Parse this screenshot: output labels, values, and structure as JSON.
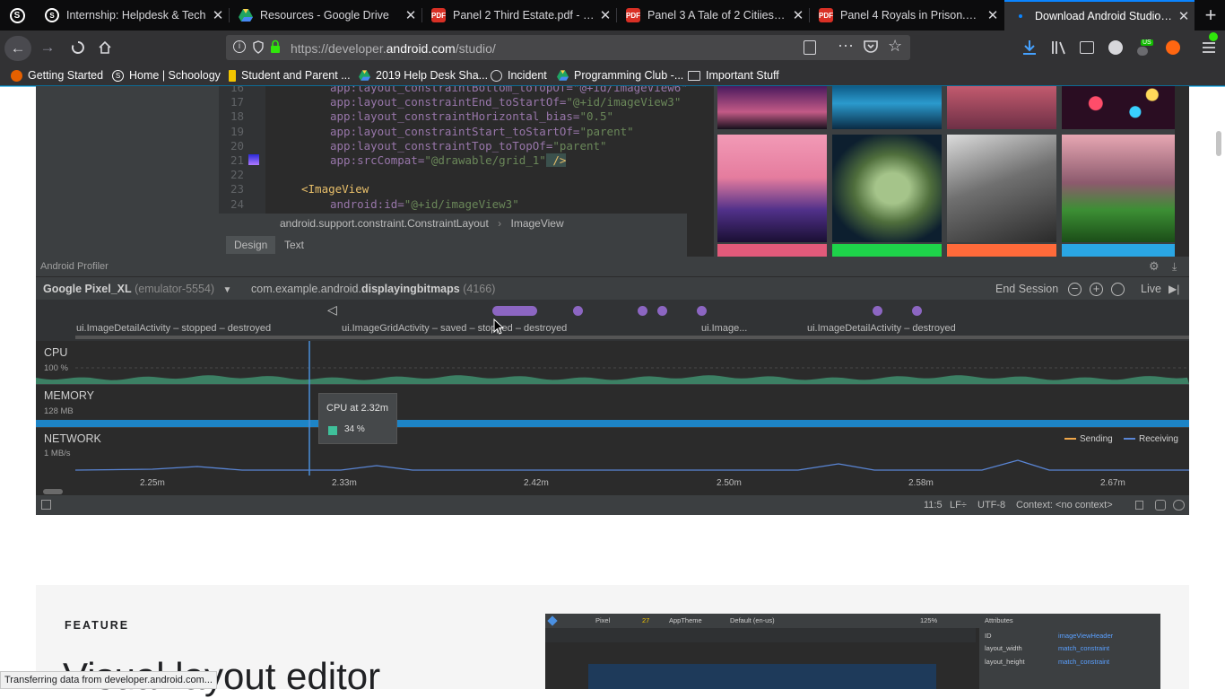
{
  "browser": {
    "tabs": [
      {
        "label": "Internship: Helpdesk & Tech",
        "icon": "schoology-icon"
      },
      {
        "label": "Resources - Google Drive",
        "icon": "google-drive-icon"
      },
      {
        "label": "Panel 2 Third Estate.pdf - Go",
        "icon": "pdf-icon"
      },
      {
        "label": "Panel 3 A Tale of 2 Citiies.pdf",
        "icon": "pdf-icon"
      },
      {
        "label": "Panel 4 Royals in Prison.pdf -",
        "icon": "pdf-icon"
      },
      {
        "label": "Download Android Studio and",
        "icon": "loading-dot-icon"
      }
    ],
    "pdf_badge": "PDF",
    "url_host_prefix": "https://developer.",
    "url_host_main": "android.com",
    "url_path": "/studio/",
    "bookmarks": [
      {
        "label": "Getting Started",
        "icon": "firefox-icon"
      },
      {
        "label": "Home | Schoology",
        "icon": "schoology-icon"
      },
      {
        "label": "Student and Parent ...",
        "icon": "bookmark-flag-icon"
      },
      {
        "label": "2019 Help Desk Sha...",
        "icon": "google-drive-icon"
      },
      {
        "label": "Incident",
        "icon": "globe-icon"
      },
      {
        "label": "Programming Club -...",
        "icon": "google-drive-icon"
      },
      {
        "label": "Important Stuff",
        "icon": "folder-icon"
      }
    ],
    "extension_badge": "US",
    "status_text": "Transferring data from developer.android.com..."
  },
  "code": {
    "lines": [
      {
        "num": "16",
        "text": "app:layout_constraintBottom_toTopOf=\"@+id/imageView6\""
      },
      {
        "num": "17",
        "attr": "app:layout_constraintEnd_toStartOf=",
        "val": "\"@+id/imageView3\""
      },
      {
        "num": "18",
        "attr": "app:layout_constraintHorizontal_bias=",
        "val": "\"0.5\""
      },
      {
        "num": "19",
        "attr": "app:layout_constraintStart_toStartOf=",
        "val": "\"parent\""
      },
      {
        "num": "20",
        "attr": "app:layout_constraintTop_toTopOf=",
        "val": "\"parent\""
      },
      {
        "num": "21",
        "attr": "app:srcCompat=",
        "val": "\"@drawable/grid_1\"",
        "tail": " />"
      },
      {
        "num": "22",
        "attr": "",
        "val": ""
      },
      {
        "num": "23",
        "tag": "<ImageView"
      },
      {
        "num": "24",
        "attr": "android:id=",
        "val": "\"@+id/imageView3\""
      }
    ],
    "breadcrumb_parent": "android.support.constraint.ConstraintLayout",
    "breadcrumb_child": "ImageView",
    "tab_design": "Design",
    "tab_text": "Text"
  },
  "profiler": {
    "title": "Android Profiler",
    "device": "Google Pixel_XL",
    "device_detail": "(emulator-5554)",
    "process_prefix": "com.example.android.",
    "process_name": "displayingbitmaps",
    "process_pid": "(4166)",
    "end_session": "End Session",
    "live": "Live",
    "activities": [
      "ui.ImageDetailActivity – stopped – destroyed",
      "ui.ImageGridActivity – saved – stopped – destroyed",
      "ui.Image...",
      "ui.ImageDetailActivity – destroyed"
    ],
    "monitors": [
      {
        "label": "CPU",
        "scale": "100 %"
      },
      {
        "label": "MEMORY",
        "scale": "128 MB"
      },
      {
        "label": "NETWORK",
        "scale": "1 MB/s"
      }
    ],
    "legend_sending": "Sending",
    "legend_receiving": "Receiving",
    "tooltip_title": "CPU at 2.32m",
    "tooltip_value": "34 %",
    "ticks": [
      "2.25m",
      "2.33m",
      "2.42m",
      "2.50m",
      "2.58m",
      "2.67m"
    ],
    "status": {
      "position": "11:5",
      "line_sep": "LF÷",
      "encoding": "UTF-8",
      "context": "Context: <no context>"
    },
    "colors": {
      "cpu": "#3f8f6e",
      "memory": "#1d84c6",
      "events": "#8c66c2",
      "sending": "#f0a74a",
      "receiving": "#5a86d6"
    }
  },
  "feature": {
    "kicker": "FEATURE",
    "heading": "Visual layout editor"
  },
  "layout_editor": {
    "device": "Pixel",
    "api": "27",
    "theme": "AppTheme",
    "locale": "Default (en-us)",
    "zoom": "125%",
    "attributes_title": "Attributes",
    "attr_rows": [
      {
        "label": "ID",
        "value": "imageViewHeader"
      },
      {
        "label": "layout_width",
        "value": "match_constraint"
      },
      {
        "label": "layout_height",
        "value": "match_constraint"
      }
    ]
  }
}
